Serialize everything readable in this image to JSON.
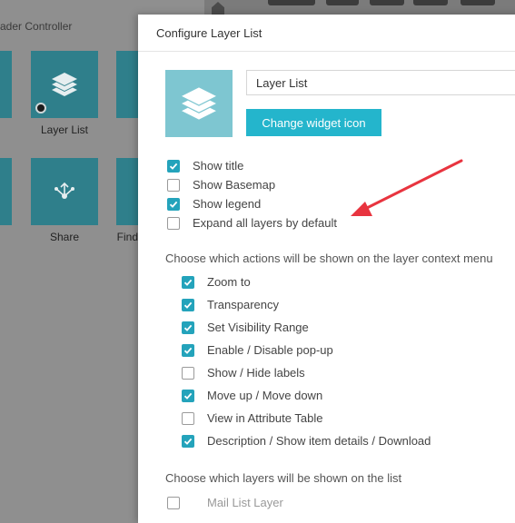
{
  "background": {
    "panel_title": "ader Controller",
    "tiles": [
      {
        "label": "Layer List",
        "icon": "layers-icon"
      },
      {
        "label": "Share",
        "icon": "share-icon"
      },
      {
        "label": "Find",
        "icon": "find-icon"
      }
    ]
  },
  "dialog": {
    "title": "Configure Layer List",
    "widget_name": "Layer List",
    "change_icon_label": "Change widget icon",
    "options": [
      {
        "label": "Show title",
        "checked": true
      },
      {
        "label": "Show Basemap",
        "checked": false
      },
      {
        "label": "Show legend",
        "checked": true
      },
      {
        "label": "Expand all layers by default",
        "checked": false
      }
    ],
    "actions_heading": "Choose which actions will be shown on the layer context menu",
    "actions": [
      {
        "label": "Zoom to",
        "checked": true
      },
      {
        "label": "Transparency",
        "checked": true
      },
      {
        "label": "Set Visibility Range",
        "checked": true
      },
      {
        "label": "Enable / Disable pop-up",
        "checked": true
      },
      {
        "label": "Show / Hide labels",
        "checked": false
      },
      {
        "label": "Move up / Move down",
        "checked": true
      },
      {
        "label": "View in Attribute Table",
        "checked": false
      },
      {
        "label": "Description / Show item details / Download",
        "checked": true
      }
    ],
    "layers_heading": "Choose which layers will be shown on the list",
    "layers": [
      {
        "label": "Mail List Layer",
        "checked": false
      }
    ]
  },
  "colors": {
    "accent": "#24b5cc",
    "checkbox": "#24a3bb",
    "annotation_arrow": "#e8343f"
  }
}
